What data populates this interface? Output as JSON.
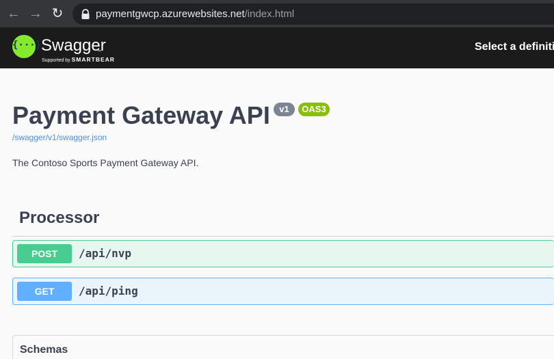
{
  "browser": {
    "url_host": "paymentgwcp.azurewebsites.net",
    "url_path": "/index.html",
    "back_icon": "←",
    "forward_icon": "→",
    "reload_icon": "↻"
  },
  "topbar": {
    "logo_text": "Swagger",
    "logo_mark": "{···}",
    "logo_tm": "™",
    "supported_by": "Supported by",
    "smartbear": "SMARTBEAR",
    "select_definition": "Select a definition"
  },
  "info": {
    "title": "Payment Gateway API",
    "version": "v1",
    "oas": "OAS3",
    "spec_link": "/swagger/v1/swagger.json",
    "description": "The Contoso Sports Payment Gateway API."
  },
  "tag": {
    "name": "Processor",
    "operations": [
      {
        "method": "POST",
        "path": "/api/nvp"
      },
      {
        "method": "GET",
        "path": "/api/ping"
      }
    ]
  },
  "schemas": {
    "title": "Schemas"
  },
  "colors": {
    "post": "#49cc90",
    "get": "#61affe",
    "accent": "#85ea2d",
    "text": "#3b4151"
  }
}
